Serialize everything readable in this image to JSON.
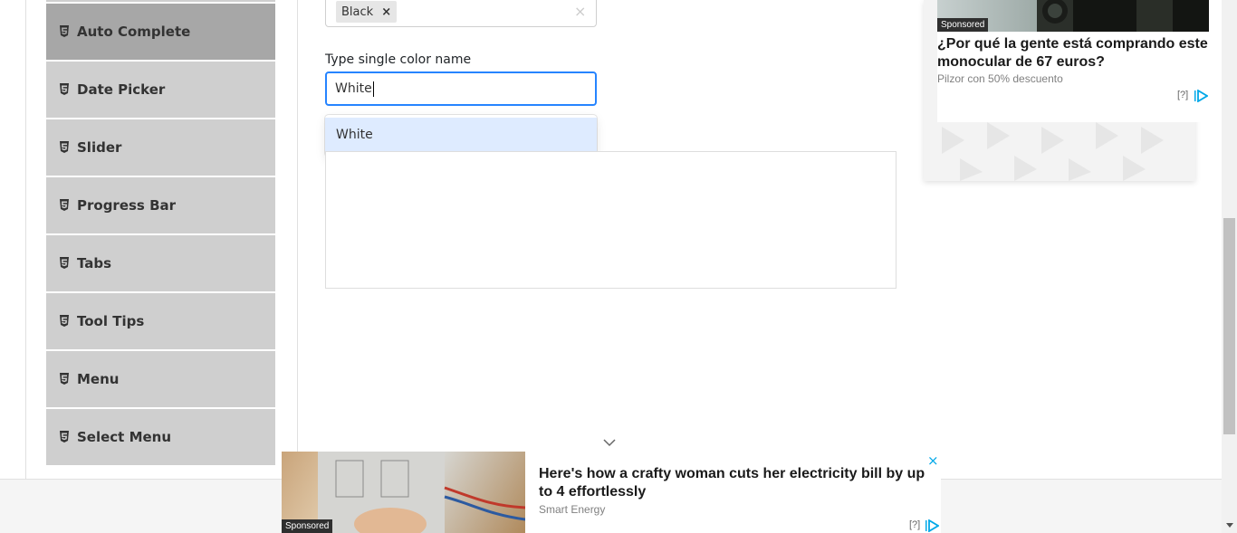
{
  "sidebar": {
    "items": [
      {
        "label": "Auto Complete",
        "icon": "html5-icon",
        "active": true
      },
      {
        "label": "Date Picker",
        "icon": "html5-icon",
        "active": false
      },
      {
        "label": "Slider",
        "icon": "html5-icon",
        "active": false
      },
      {
        "label": "Progress Bar",
        "icon": "html5-icon",
        "active": false
      },
      {
        "label": "Tabs",
        "icon": "html5-icon",
        "active": false
      },
      {
        "label": "Tool Tips",
        "icon": "html5-icon",
        "active": false
      },
      {
        "label": "Menu",
        "icon": "html5-icon",
        "active": false
      },
      {
        "label": "Select Menu",
        "icon": "html5-icon",
        "active": false
      }
    ]
  },
  "multi_select": {
    "chips": [
      "Black"
    ],
    "remove_symbol": "×",
    "clear_symbol": "×"
  },
  "single_select": {
    "label": "Type single color name",
    "value": "White",
    "options": [
      "White"
    ]
  },
  "right_ad": {
    "sponsored": "Sponsored",
    "headline": "¿Por qué la gente está comprando este monocular de 67 euros?",
    "source": "Pilzor con 50% descuento",
    "info": "[?]"
  },
  "bottom_ad": {
    "sponsored": "Sponsored",
    "headline": "Here's how a crafty woman cuts her electricity bill by up to 4 effortlessly",
    "source": "Smart Energy",
    "close": "×",
    "info": "[?]"
  },
  "colors": {
    "sidebar_item": "#cfcfcf",
    "sidebar_active": "#a7a7a7",
    "focus_border": "#2684ff",
    "option_highlight": "#deebff",
    "ad_close": "#00a8e8"
  }
}
